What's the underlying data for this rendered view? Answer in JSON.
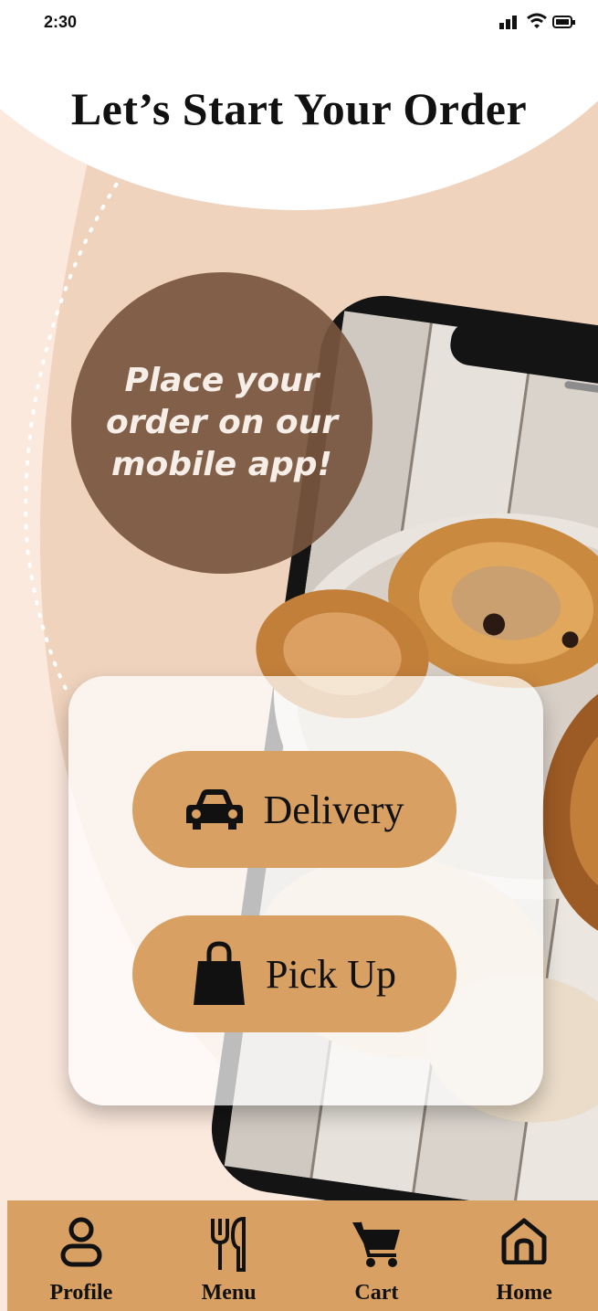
{
  "status_bar": {
    "time": "2:30"
  },
  "header": {
    "title": "Let’s Start Your Order"
  },
  "promo": {
    "text": "Place your order on our mobile app!"
  },
  "order_options": {
    "delivery_label": "Delivery",
    "pickup_label": "Pick Up"
  },
  "tab_bar": {
    "items": [
      {
        "label": "Profile",
        "icon": "profile-icon"
      },
      {
        "label": "Menu",
        "icon": "fork-knife-icon"
      },
      {
        "label": "Cart",
        "icon": "cart-icon"
      },
      {
        "label": "Home",
        "icon": "home-icon"
      }
    ]
  },
  "colors": {
    "background": "#fbe9dd",
    "arc_tan": "#efd3bd",
    "promo_brown": "#78553f",
    "accent_tan": "#d8a062",
    "text_dark": "#111111"
  }
}
